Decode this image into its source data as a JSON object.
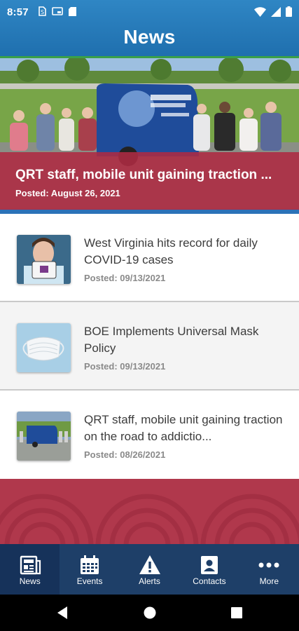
{
  "status_bar": {
    "time": "8:57",
    "icons": [
      "sim-icon",
      "cast-icon",
      "sd-card-icon",
      "wifi-icon",
      "signal-icon",
      "battery-icon"
    ]
  },
  "header": {
    "title": "News"
  },
  "featured": {
    "title": "QRT staff, mobile unit gaining traction ...",
    "date": "Posted: August 26, 2021"
  },
  "articles": [
    {
      "title": " West Virginia hits record for daily COVID-19 cases",
      "date": "Posted: 09/13/2021",
      "thumb": "covid-test-photo"
    },
    {
      "title": "BOE Implements Universal Mask Policy",
      "date": "Posted: 09/13/2021",
      "thumb": "face-mask-photo"
    },
    {
      "title": "QRT staff, mobile unit gaining traction on the  road to addictio...",
      "date": "Posted: 08/26/2021",
      "thumb": "mobile-unit-photo"
    }
  ],
  "tabs": [
    {
      "label": "News",
      "icon": "newspaper-icon",
      "active": true
    },
    {
      "label": "Events",
      "icon": "calendar-icon",
      "active": false
    },
    {
      "label": "Alerts",
      "icon": "alert-icon",
      "active": false
    },
    {
      "label": "Contacts",
      "icon": "contact-card-icon",
      "active": false
    },
    {
      "label": "More",
      "icon": "more-dots-icon",
      "active": false
    }
  ],
  "colors": {
    "header_blue": "#2f86c4",
    "accent_red": "#ae2a42",
    "tabbar_navy": "#1e3f68",
    "divider_blue": "#2b72b8",
    "accent_green": "#3aa048"
  }
}
